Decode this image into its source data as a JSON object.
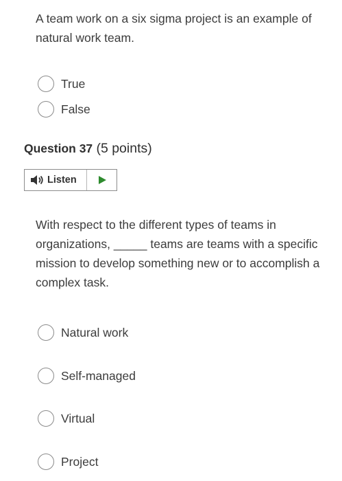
{
  "previous_question": {
    "text": "A team work on a six sigma project is an example of natural work team.",
    "options": [
      "True",
      "False"
    ]
  },
  "question": {
    "number_label": "Question 37",
    "points_label": "(5 points)",
    "listen_label": "Listen",
    "text": "With respect to the different types of teams in organizations, _____ teams are teams with a specific mission to develop something new or to accomplish a complex task.",
    "options": [
      "Natural work",
      "Self-managed",
      "Virtual",
      "Project"
    ]
  },
  "colors": {
    "text": "#3c3c3c",
    "radio_border": "#8a8a8a",
    "play_green": "#2e8b2e",
    "speaker_dark": "#333333"
  },
  "icons": {
    "listen": "speaker-icon",
    "play": "play-icon",
    "radio": "radio-icon"
  }
}
